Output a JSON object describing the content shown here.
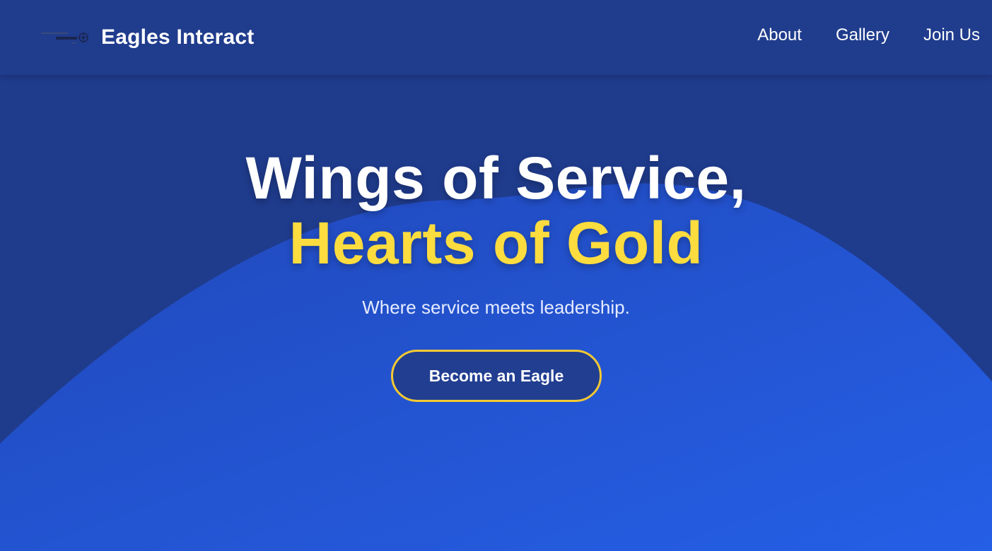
{
  "header": {
    "brand_name": "Eagles Interact",
    "logo_icon": "interact-club-logo-icon",
    "nav": [
      {
        "label": "About"
      },
      {
        "label": "Gallery"
      },
      {
        "label": "Join Us"
      }
    ]
  },
  "hero": {
    "headline_line1": "Wings of Service,",
    "headline_line2": "Hearts of Gold",
    "tagline": "Where service meets leadership.",
    "cta_label": "Become an Eagle"
  },
  "colors": {
    "background_dark": "#1f3b8c",
    "wave_blue": "#2554d8",
    "accent_gold": "#fcdc3e",
    "button_border": "#f5c932",
    "text_white": "#ffffff"
  }
}
